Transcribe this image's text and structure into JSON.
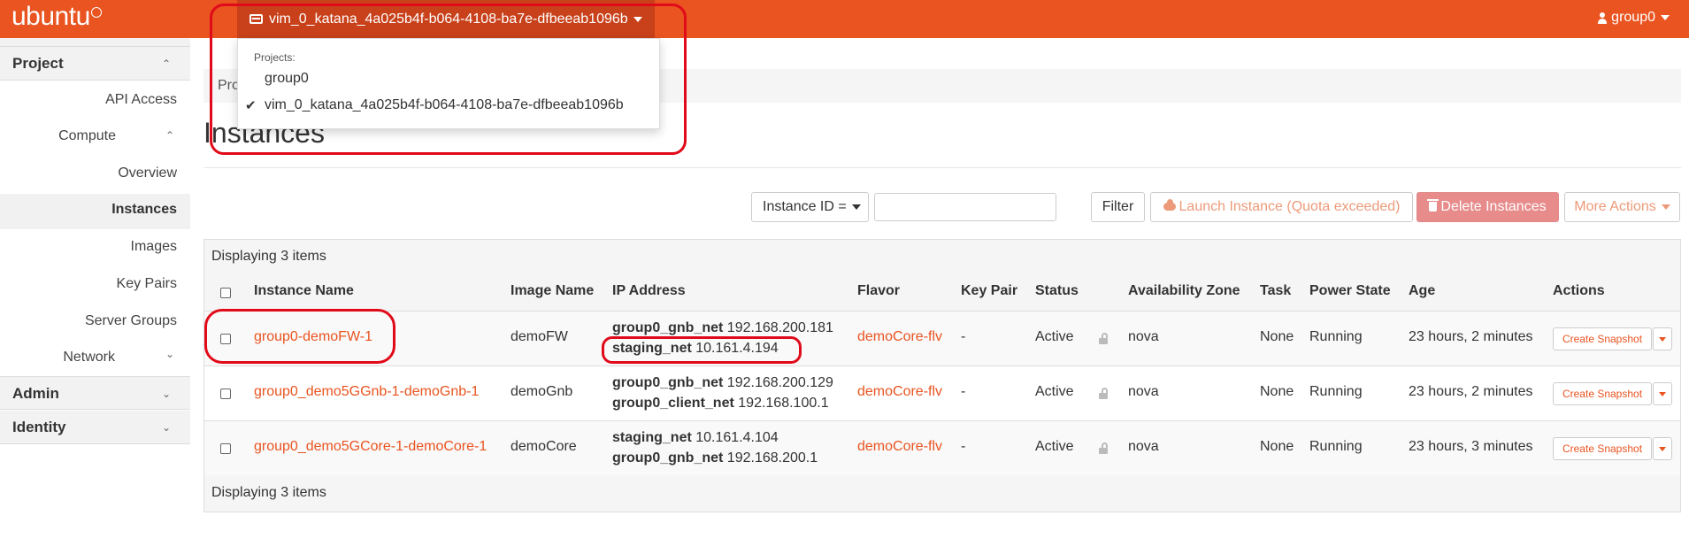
{
  "brand": {
    "logo": "ubuntu",
    "accent": "#e95420"
  },
  "topbar": {
    "project_selector": "vim_0_katana_4a025b4f-b064-4108-ba7e-dfbeeab1096b",
    "user": "group0",
    "icons": {
      "project": "server-icon",
      "user": "user-icon",
      "caret": "caret-down-icon"
    }
  },
  "project_dropdown": {
    "header": "Projects:",
    "items": [
      {
        "label": "group0",
        "selected": false
      },
      {
        "label": "vim_0_katana_4a025b4f-b064-4108-ba7e-dfbeeab1096b",
        "selected": true
      }
    ],
    "check_glyph": "✔"
  },
  "sidebar": {
    "project": "Project",
    "api_access": "API Access",
    "compute": "Compute",
    "overview": "Overview",
    "instances": "Instances",
    "images": "Images",
    "key_pairs": "Key Pairs",
    "server_groups": "Server Groups",
    "network": "Network",
    "admin": "Admin",
    "identity": "Identity",
    "chev_up": "⌃",
    "chev_down": "⌄"
  },
  "breadcrumb": "Pro",
  "page_title": "Instances",
  "toolbar": {
    "filter_field": "Instance ID =",
    "filter_value": "",
    "filter_button": "Filter",
    "launch": "Launch Instance (Quota exceeded)",
    "delete": "Delete Instances",
    "more": "More Actions"
  },
  "table": {
    "count_text": "Displaying 3 items",
    "headers": {
      "name": "Instance Name",
      "image": "Image Name",
      "ip": "IP Address",
      "flavor": "Flavor",
      "keypair": "Key Pair",
      "status": "Status",
      "az": "Availability Zone",
      "task": "Task",
      "power": "Power State",
      "age": "Age",
      "actions": "Actions"
    },
    "rows": [
      {
        "name": "group0-demoFW-1",
        "image": "demoFW",
        "ip1_net": "group0_gnb_net",
        "ip1_addr": "192.168.200.181",
        "ip2_net": "staging_net",
        "ip2_addr": "10.161.4.194",
        "flavor": "demoCore-flv",
        "keypair": "-",
        "status": "Active",
        "az": "nova",
        "task": "None",
        "power": "Running",
        "age": "23 hours, 2 minutes",
        "action": "Create Snapshot"
      },
      {
        "name": "group0_demo5GGnb-1-demoGnb-1",
        "image": "demoGnb",
        "ip1_net": "group0_gnb_net",
        "ip1_addr": "192.168.200.129",
        "ip2_net": "group0_client_net",
        "ip2_addr": "192.168.100.1",
        "flavor": "demoCore-flv",
        "keypair": "-",
        "status": "Active",
        "az": "nova",
        "task": "None",
        "power": "Running",
        "age": "23 hours, 2 minutes",
        "action": "Create Snapshot"
      },
      {
        "name": "group0_demo5GCore-1-demoCore-1",
        "image": "demoCore",
        "ip1_net": "staging_net",
        "ip1_addr": "10.161.4.104",
        "ip2_net": "group0_gnb_net",
        "ip2_addr": "192.168.200.1",
        "flavor": "demoCore-flv",
        "keypair": "-",
        "status": "Active",
        "az": "nova",
        "task": "None",
        "power": "Running",
        "age": "23 hours, 3 minutes",
        "action": "Create Snapshot"
      }
    ]
  },
  "annotation_color": "#e10a1a"
}
